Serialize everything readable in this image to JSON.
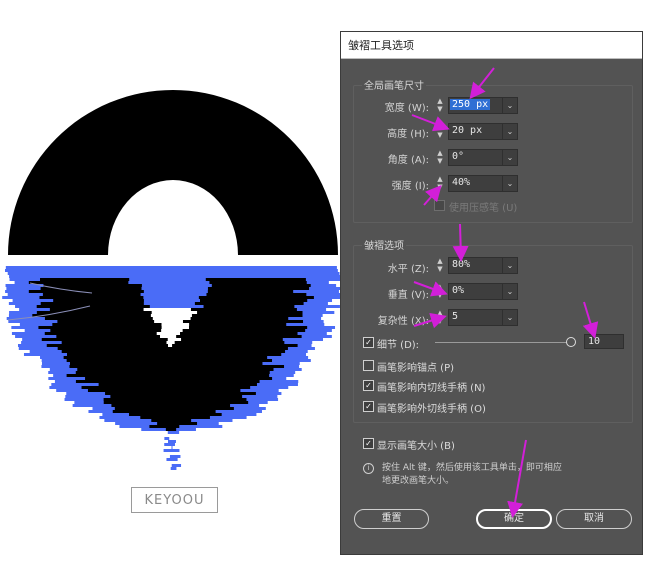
{
  "watermark": {
    "text": "KEYOOU"
  },
  "dialog": {
    "title": "皱褶工具选项",
    "brush_group": {
      "title": "全局画笔尺寸",
      "rows": [
        {
          "label": "宽度 (W):",
          "value": "250 px",
          "selected": true
        },
        {
          "label": "高度 (H):",
          "value": "20 px"
        },
        {
          "label": "角度 (A):",
          "value": "0°"
        },
        {
          "label": "强度 (I):",
          "value": "40%"
        }
      ],
      "pressure": {
        "label": "使用压感笔 (U)",
        "checked": false,
        "disabled": true
      }
    },
    "options_group": {
      "title": "皱褶选项",
      "rows": [
        {
          "label": "水平 (Z):",
          "value": "80%"
        },
        {
          "label": "垂直 (V):",
          "value": "0%"
        },
        {
          "label": "复杂性 (X):",
          "value": "5"
        }
      ],
      "detail": {
        "label": "细节 (D):",
        "value": "10",
        "checked": true,
        "level": 1.0
      },
      "checkboxes": [
        {
          "label": "画笔影响锚点 (P)",
          "checked": false
        },
        {
          "label": "画笔影响内切线手柄 (N)",
          "checked": true
        },
        {
          "label": "画笔影响外切线手柄 (O)",
          "checked": true
        }
      ]
    },
    "show_brush_size": {
      "label": "显示画笔大小 (B)",
      "checked": true
    },
    "info": "按住 Alt 键，然后使用该工具单击，即可相应地更改画笔大小。",
    "buttons": {
      "reset": "重置",
      "ok": "确定",
      "cancel": "取消"
    }
  },
  "colors": {
    "dialog_bg": "#535353",
    "wave_blue": "#4a6cf7",
    "arrow_magenta": "#d21fd8",
    "selection_blue": "#2f6fd4"
  }
}
